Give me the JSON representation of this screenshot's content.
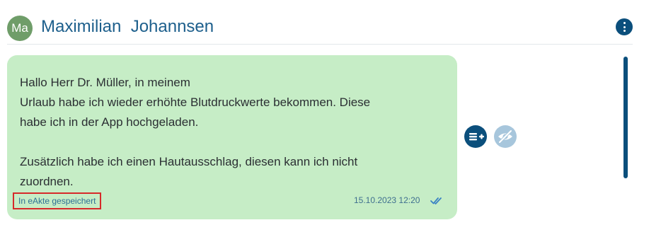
{
  "contact": {
    "avatar_initials": "Ma",
    "name": "Maximilian  Johannsen"
  },
  "message": {
    "lines": [
      "Hallo Herr Dr. Müller, in meinem",
      "Urlaub habe ich wieder erhöhte Blutdruckwerte bekommen. Diese",
      "habe ich in der App hochgeladen.",
      "",
      "Zusätzlich habe ich einen Hautausschlag, diesen kann ich nicht",
      "zuordnen."
    ],
    "saved_status": "In eAkte gespeichert",
    "timestamp": "15.10.2023 12:20",
    "read_status_icon": "double-check-icon"
  },
  "actions": {
    "add_to_record_icon": "list-add-icon",
    "hide_icon": "eye-off-icon"
  },
  "colors": {
    "brand_dark": "#0b4f7c",
    "name_blue": "#1d5f8c",
    "avatar_green": "#6f9d69",
    "bubble_green": "#c6edc6",
    "highlight_red": "#d62a2a"
  }
}
